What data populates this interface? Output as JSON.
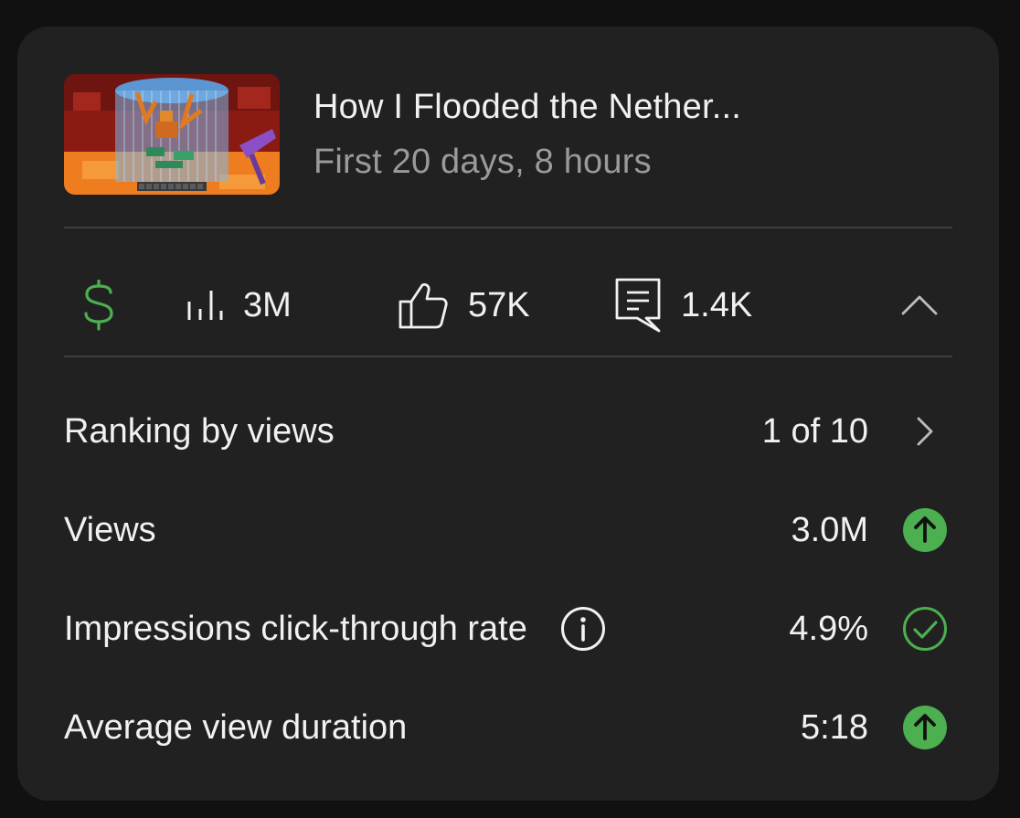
{
  "video": {
    "title": "How I Flooded the Nether...",
    "period": "First 20 days, 8 hours",
    "thumbnail_icon": "minecraft-nether-thumbnail"
  },
  "stats": {
    "monetization_icon": "dollar-icon",
    "views_icon": "bar-chart-icon",
    "views": "3M",
    "likes_icon": "thumbs-up-icon",
    "likes": "57K",
    "comments_icon": "comment-icon",
    "comments": "1.4K",
    "collapse_icon": "chevron-up-icon"
  },
  "metrics": [
    {
      "label": "Ranking by views",
      "value": "1 of 10",
      "icon": "chevron-right-icon"
    },
    {
      "label": "Views",
      "value": "3.0M",
      "icon": "arrow-up-circle-icon"
    },
    {
      "label": "Impressions click-through rate",
      "value": "4.9%",
      "icon": "check-circle-icon",
      "info_icon": "info-icon"
    },
    {
      "label": "Average view duration",
      "value": "5:18",
      "icon": "arrow-up-circle-icon"
    }
  ],
  "colors": {
    "card_bg": "#212121",
    "page_bg": "#111111",
    "accent_green": "#4caf50",
    "secondary_text": "#9a9a9a"
  }
}
